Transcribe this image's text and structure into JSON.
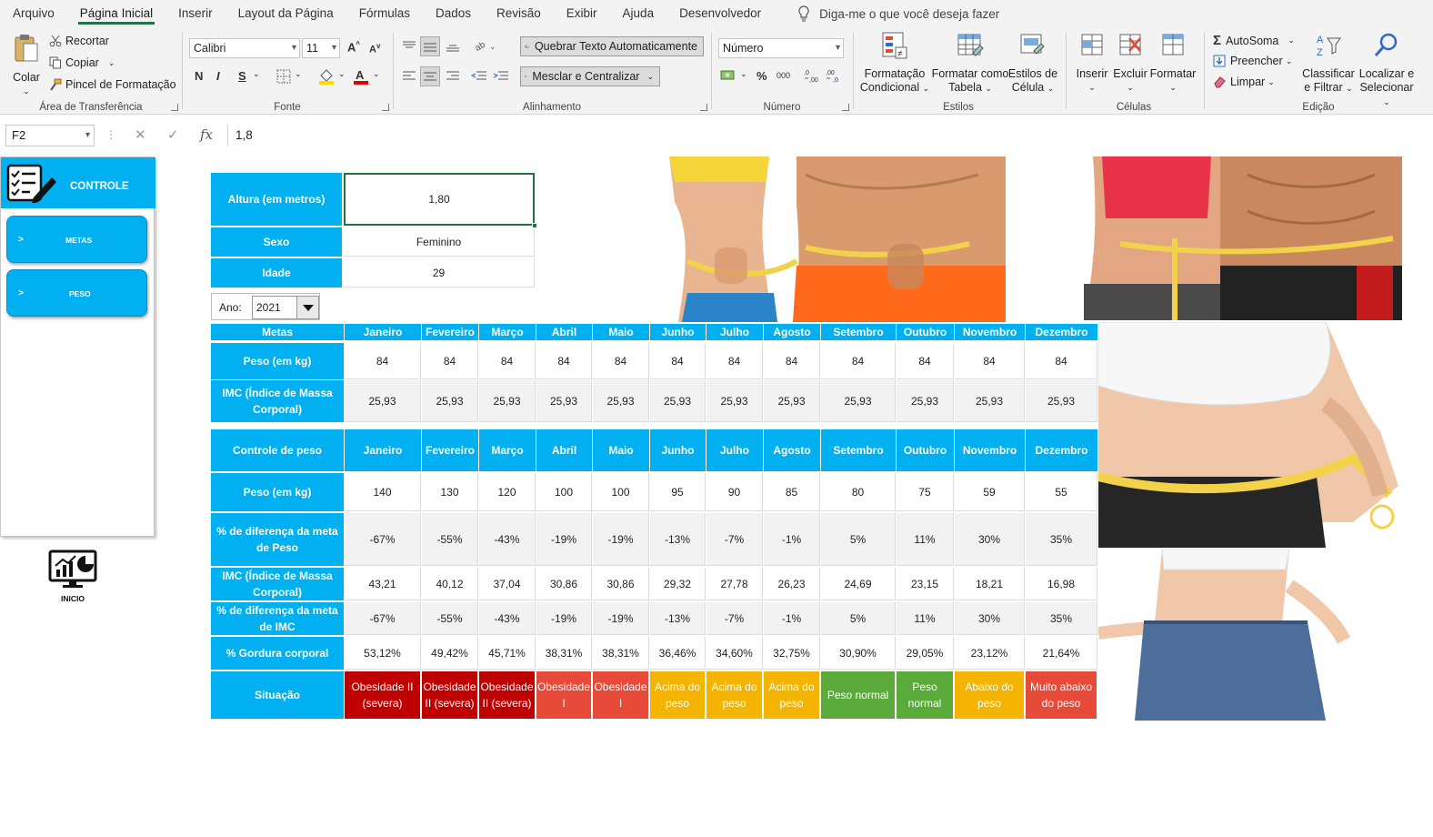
{
  "menu": {
    "tabs": [
      "Arquivo",
      "Página Inicial",
      "Inserir",
      "Layout da Página",
      "Fórmulas",
      "Dados",
      "Revisão",
      "Exibir",
      "Ajuda",
      "Desenvolvedor"
    ],
    "tell_me": "Diga-me o que você deseja fazer"
  },
  "ribbon": {
    "clipboard": {
      "paste": "Colar",
      "cut": "Recortar",
      "copy": "Copiar",
      "format_painter": "Pincel de Formatação",
      "label": "Área de Transferência"
    },
    "font": {
      "family": "Calibri",
      "size": "11",
      "label": "Fonte",
      "bold": "N",
      "italic": "I",
      "underline": "S"
    },
    "alignment": {
      "wrap": "Quebrar Texto Automaticamente",
      "merge": "Mesclar e Centralizar",
      "label": "Alinhamento"
    },
    "number": {
      "format": "Número",
      "label": "Número",
      "percent": "%",
      "thousands": "000"
    },
    "styles": {
      "conditional": [
        "Formatação",
        "Condicional"
      ],
      "as_table": [
        "Formatar como",
        "Tabela"
      ],
      "cell_styles": [
        "Estilos de",
        "Célula"
      ],
      "label": "Estilos"
    },
    "cells": {
      "insert": "Inserir",
      "delete": "Excluir",
      "format": "Formatar",
      "label": "Células"
    },
    "editing": {
      "autosum": "AutoSoma",
      "fill": "Preencher",
      "clear": "Limpar",
      "sort": [
        "Classificar",
        "e Filtrar"
      ],
      "find": [
        "Localizar e",
        "Selecionar"
      ],
      "label": "Edição"
    }
  },
  "formula_bar": {
    "name_box": "F2",
    "value": "1,8"
  },
  "sidebar": {
    "header": "CONTROLE",
    "buttons": [
      {
        "arrow": ">",
        "label": "METAS"
      },
      {
        "arrow": ">",
        "label": "PESO"
      }
    ],
    "home_label": "INICIO"
  },
  "profile": {
    "height_label": "Altura (em metros)",
    "height_value": "1,80",
    "sex_label": "Sexo",
    "sex_value": "Feminino",
    "age_label": "Idade",
    "age_value": "29",
    "year_label": "Ano:",
    "year_value": "2021"
  },
  "months": [
    "Janeiro",
    "Fevereiro",
    "Março",
    "Abril",
    "Maio",
    "Junho",
    "Julho",
    "Agosto",
    "Setembro",
    "Outubro",
    "Novembro",
    "Dezembro"
  ],
  "goals": {
    "header": "Metas",
    "rows": [
      {
        "label": "Peso (em kg)",
        "values": [
          "84",
          "84",
          "84",
          "84",
          "84",
          "84",
          "84",
          "84",
          "84",
          "84",
          "84",
          "84"
        ]
      },
      {
        "label": "IMC (Índice de Massa Corporal)",
        "values": [
          "25,93",
          "25,93",
          "25,93",
          "25,93",
          "25,93",
          "25,93",
          "25,93",
          "25,93",
          "25,93",
          "25,93",
          "25,93",
          "25,93"
        ]
      }
    ]
  },
  "control": {
    "header": "Controle de peso",
    "rows": [
      {
        "label": "Peso (em kg)",
        "values": [
          "140",
          "130",
          "120",
          "100",
          "100",
          "95",
          "90",
          "85",
          "80",
          "75",
          "59",
          "55"
        ]
      },
      {
        "label": "% de diferença da meta de Peso",
        "values": [
          "-67%",
          "-55%",
          "-43%",
          "-19%",
          "-19%",
          "-13%",
          "-7%",
          "-1%",
          "5%",
          "11%",
          "30%",
          "35%"
        ]
      },
      {
        "label": "IMC (Índice de Massa Corporal)",
        "values": [
          "43,21",
          "40,12",
          "37,04",
          "30,86",
          "30,86",
          "29,32",
          "27,78",
          "26,23",
          "24,69",
          "23,15",
          "18,21",
          "16,98"
        ]
      },
      {
        "label": "% de diferença da meta de IMC",
        "values": [
          "-67%",
          "-55%",
          "-43%",
          "-19%",
          "-19%",
          "-13%",
          "-7%",
          "-1%",
          "5%",
          "11%",
          "30%",
          "35%"
        ]
      },
      {
        "label": "% Gordura corporal",
        "values": [
          "53,12%",
          "49,42%",
          "45,71%",
          "38,31%",
          "38,31%",
          "36,46%",
          "34,60%",
          "32,75%",
          "30,90%",
          "29,05%",
          "23,12%",
          "21,64%"
        ]
      }
    ],
    "situation_label": "Situação",
    "situation": [
      {
        "text": "Obesidade II (severa)",
        "color": "#c00000"
      },
      {
        "text": "Obesidade II (severa)",
        "color": "#c00000"
      },
      {
        "text": "Obesidade II (severa)",
        "color": "#c00000"
      },
      {
        "text": "Obesidade I",
        "color": "#e84a3a"
      },
      {
        "text": "Obesidade I",
        "color": "#e84a3a"
      },
      {
        "text": "Acima do peso",
        "color": "#f5b400"
      },
      {
        "text": "Acima do peso",
        "color": "#f5b400"
      },
      {
        "text": "Acima do peso",
        "color": "#f5b400"
      },
      {
        "text": "Peso normal",
        "color": "#5aab3a"
      },
      {
        "text": "Peso normal",
        "color": "#5aab3a"
      },
      {
        "text": "Abaixo do peso",
        "color": "#f5b400"
      },
      {
        "text": "Muito abaixo do peso",
        "color": "#e84a3a"
      }
    ]
  },
  "colors": {
    "accent": "#00b0f0",
    "excel_green": "#217346",
    "grid": "#dcdcdc"
  }
}
